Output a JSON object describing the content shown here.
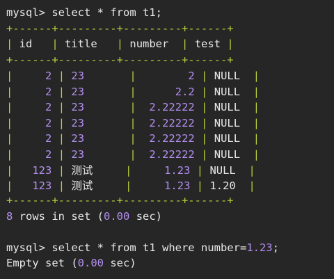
{
  "query1": {
    "prompt": "mysql>",
    "command": "select * from t1;"
  },
  "table": {
    "border": "+------+---------+---------+------+",
    "headers": [
      "id",
      "title",
      "number",
      "test"
    ],
    "rows": [
      [
        "2",
        "23",
        "2",
        "NULL"
      ],
      [
        "2",
        "23",
        "2.2",
        "NULL"
      ],
      [
        "2",
        "23",
        "2.22222",
        "NULL"
      ],
      [
        "2",
        "23",
        "2.22222",
        "NULL"
      ],
      [
        "2",
        "23",
        "2.22222",
        "NULL"
      ],
      [
        "2",
        "23",
        "2.22222",
        "NULL"
      ],
      [
        "123",
        "测试",
        "1.23",
        "NULL"
      ],
      [
        "123",
        "测试",
        "1.23",
        "1.20"
      ]
    ]
  },
  "result1": {
    "count": "8",
    "text_a": "rows in set (",
    "time": "0.00",
    "text_b": "sec)"
  },
  "query2": {
    "prompt": "mysql>",
    "command": "select * from t1 where number=",
    "value": "1.23",
    "end": ";"
  },
  "result2": {
    "text_a": "Empty set (",
    "time": "0.00",
    "text_b": "sec)"
  },
  "colors": {
    "background": "#262626",
    "border": "#b6ce3d",
    "number": "#b48ff0",
    "text": "#e8e8e8"
  }
}
